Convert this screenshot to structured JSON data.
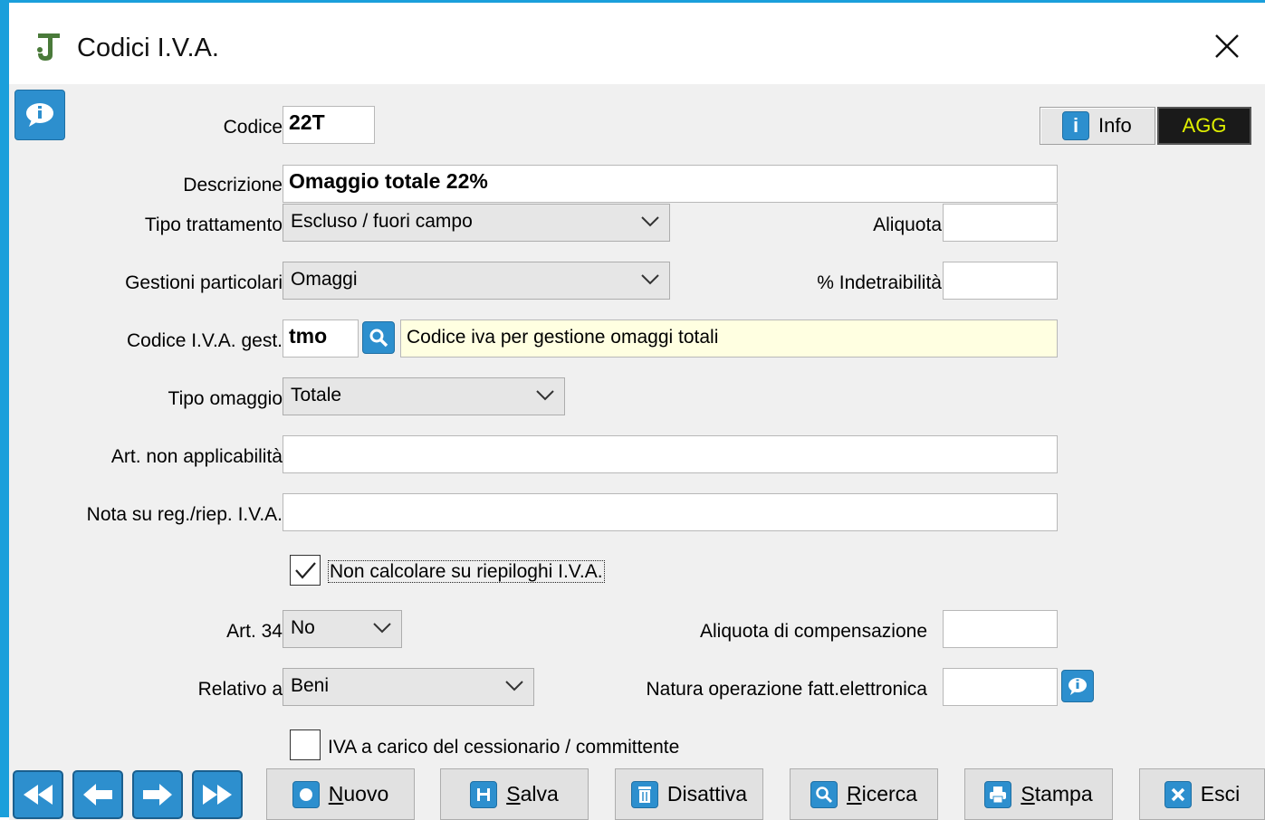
{
  "window": {
    "title": "Codici I.V.A."
  },
  "header": {
    "info_label": "Info",
    "mode_label": "AGG"
  },
  "form": {
    "codice": {
      "label": "Codice",
      "value": "22T"
    },
    "descrizione": {
      "label": "Descrizione",
      "value": "Omaggio totale 22%"
    },
    "tipo_trattamento": {
      "label": "Tipo trattamento",
      "value": "Escluso / fuori campo"
    },
    "aliquota": {
      "label": "Aliquota",
      "value": ""
    },
    "gestioni_particolari": {
      "label": "Gestioni particolari",
      "value": "Omaggi"
    },
    "indetraibilita": {
      "label": "% Indetraibilità",
      "value": ""
    },
    "codice_iva_gest": {
      "label": "Codice I.V.A. gest.",
      "value": "tmo",
      "description": "Codice iva per gestione omaggi totali"
    },
    "tipo_omaggio": {
      "label": "Tipo omaggio",
      "value": "Totale"
    },
    "art_non_applicabilita": {
      "label": "Art. non applicabilità",
      "value": ""
    },
    "nota_reg": {
      "label": "Nota su reg./riep. I.V.A.",
      "value": ""
    },
    "non_calcolare": {
      "label": "Non calcolare su riepiloghi I.V.A.",
      "checked": true
    },
    "art34": {
      "label": "Art. 34",
      "value": "No"
    },
    "aliquota_compensazione": {
      "label": "Aliquota di compensazione",
      "value": ""
    },
    "relativo_a": {
      "label": "Relativo a",
      "value": "Beni"
    },
    "natura_operazione": {
      "label": "Natura operazione fatt.elettronica",
      "value": ""
    },
    "iva_carico": {
      "label": "IVA a carico del cessionario / committente",
      "checked": false
    }
  },
  "toolbar": {
    "nav_icons": [
      "first-record-icon",
      "previous-record-icon",
      "next-record-icon",
      "last-record-icon"
    ],
    "nuovo": {
      "hotkey": "N",
      "rest": "uovo"
    },
    "salva": {
      "hotkey": "S",
      "rest": "alva"
    },
    "disattiva": {
      "label": "Disattiva"
    },
    "ricerca": {
      "hotkey": "R",
      "rest": "icerca"
    },
    "stampa": {
      "hotkey": "S",
      "rest": "tampa"
    },
    "esci": {
      "label": "Esci"
    }
  },
  "colors": {
    "accent": "#1a9fdb",
    "button_blue": "#2d8fce",
    "agg_bg": "#1a1a1a",
    "agg_text": "#e0f000",
    "lookup_bg": "#ffffe1"
  }
}
